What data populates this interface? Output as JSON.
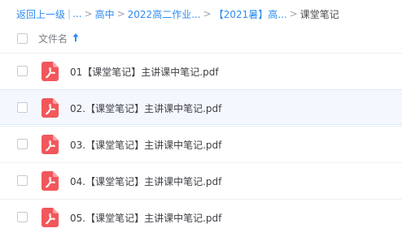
{
  "breadcrumb": {
    "back": "返回上一级",
    "bar": "|",
    "ellipsis": "...",
    "sep": ">",
    "items": [
      "高中",
      "2022高二作业...",
      "【2021暑】高..."
    ],
    "current": "课堂笔记"
  },
  "header": {
    "name_label": "文件名",
    "sort_icon": "arrow-up-icon"
  },
  "colors": {
    "link": "#2d8cf0",
    "pdf_icon": "#f2575b",
    "row_highlight": "#f4f8fe"
  },
  "files": [
    {
      "name": "01【课堂笔记】主讲课中笔记.pdf",
      "icon": "pdf-file-icon"
    },
    {
      "name": "02.【课堂笔记】主讲课中笔记.pdf",
      "icon": "pdf-file-icon"
    },
    {
      "name": "03.【课堂笔记】主讲课中笔记.pdf",
      "icon": "pdf-file-icon"
    },
    {
      "name": "04.【课堂笔记】主讲课中笔记.pdf",
      "icon": "pdf-file-icon"
    },
    {
      "name": "05.【课堂笔记】主讲课中笔记.pdf",
      "icon": "pdf-file-icon"
    }
  ]
}
